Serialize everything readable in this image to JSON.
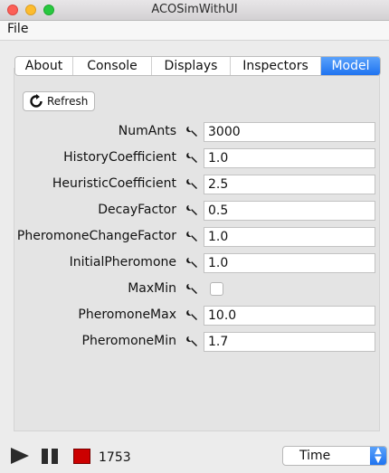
{
  "window": {
    "title": "ACOSimWithUI"
  },
  "menubar": {
    "items": [
      {
        "label": "File"
      }
    ]
  },
  "tabs": [
    {
      "label": "About",
      "active": false
    },
    {
      "label": "Console",
      "active": false
    },
    {
      "label": "Displays",
      "active": false
    },
    {
      "label": "Inspectors",
      "active": false
    },
    {
      "label": "Model",
      "active": true
    }
  ],
  "refresh": {
    "label": "Refresh",
    "icon": "refresh-icon"
  },
  "properties": [
    {
      "label": "NumAnts",
      "value": "3000",
      "type": "text"
    },
    {
      "label": "HistoryCoefficient",
      "value": "1.0",
      "type": "text"
    },
    {
      "label": "HeuristicCoefficient",
      "value": "2.5",
      "type": "text"
    },
    {
      "label": "DecayFactor",
      "value": "0.5",
      "type": "text"
    },
    {
      "label": "PheromoneChangeFactor",
      "value": "1.0",
      "type": "text"
    },
    {
      "label": "InitialPheromone",
      "value": "1.0",
      "type": "text"
    },
    {
      "label": "MaxMin",
      "checked": false,
      "type": "checkbox"
    },
    {
      "label": "PheromoneMax",
      "value": "10.0",
      "type": "text"
    },
    {
      "label": "PheromoneMin",
      "value": "1.7",
      "type": "text"
    }
  ],
  "controls": {
    "step_count": "1753",
    "time_select": "Time"
  },
  "colors": {
    "accent": "#1f73f0",
    "stop": "#cc0000"
  }
}
